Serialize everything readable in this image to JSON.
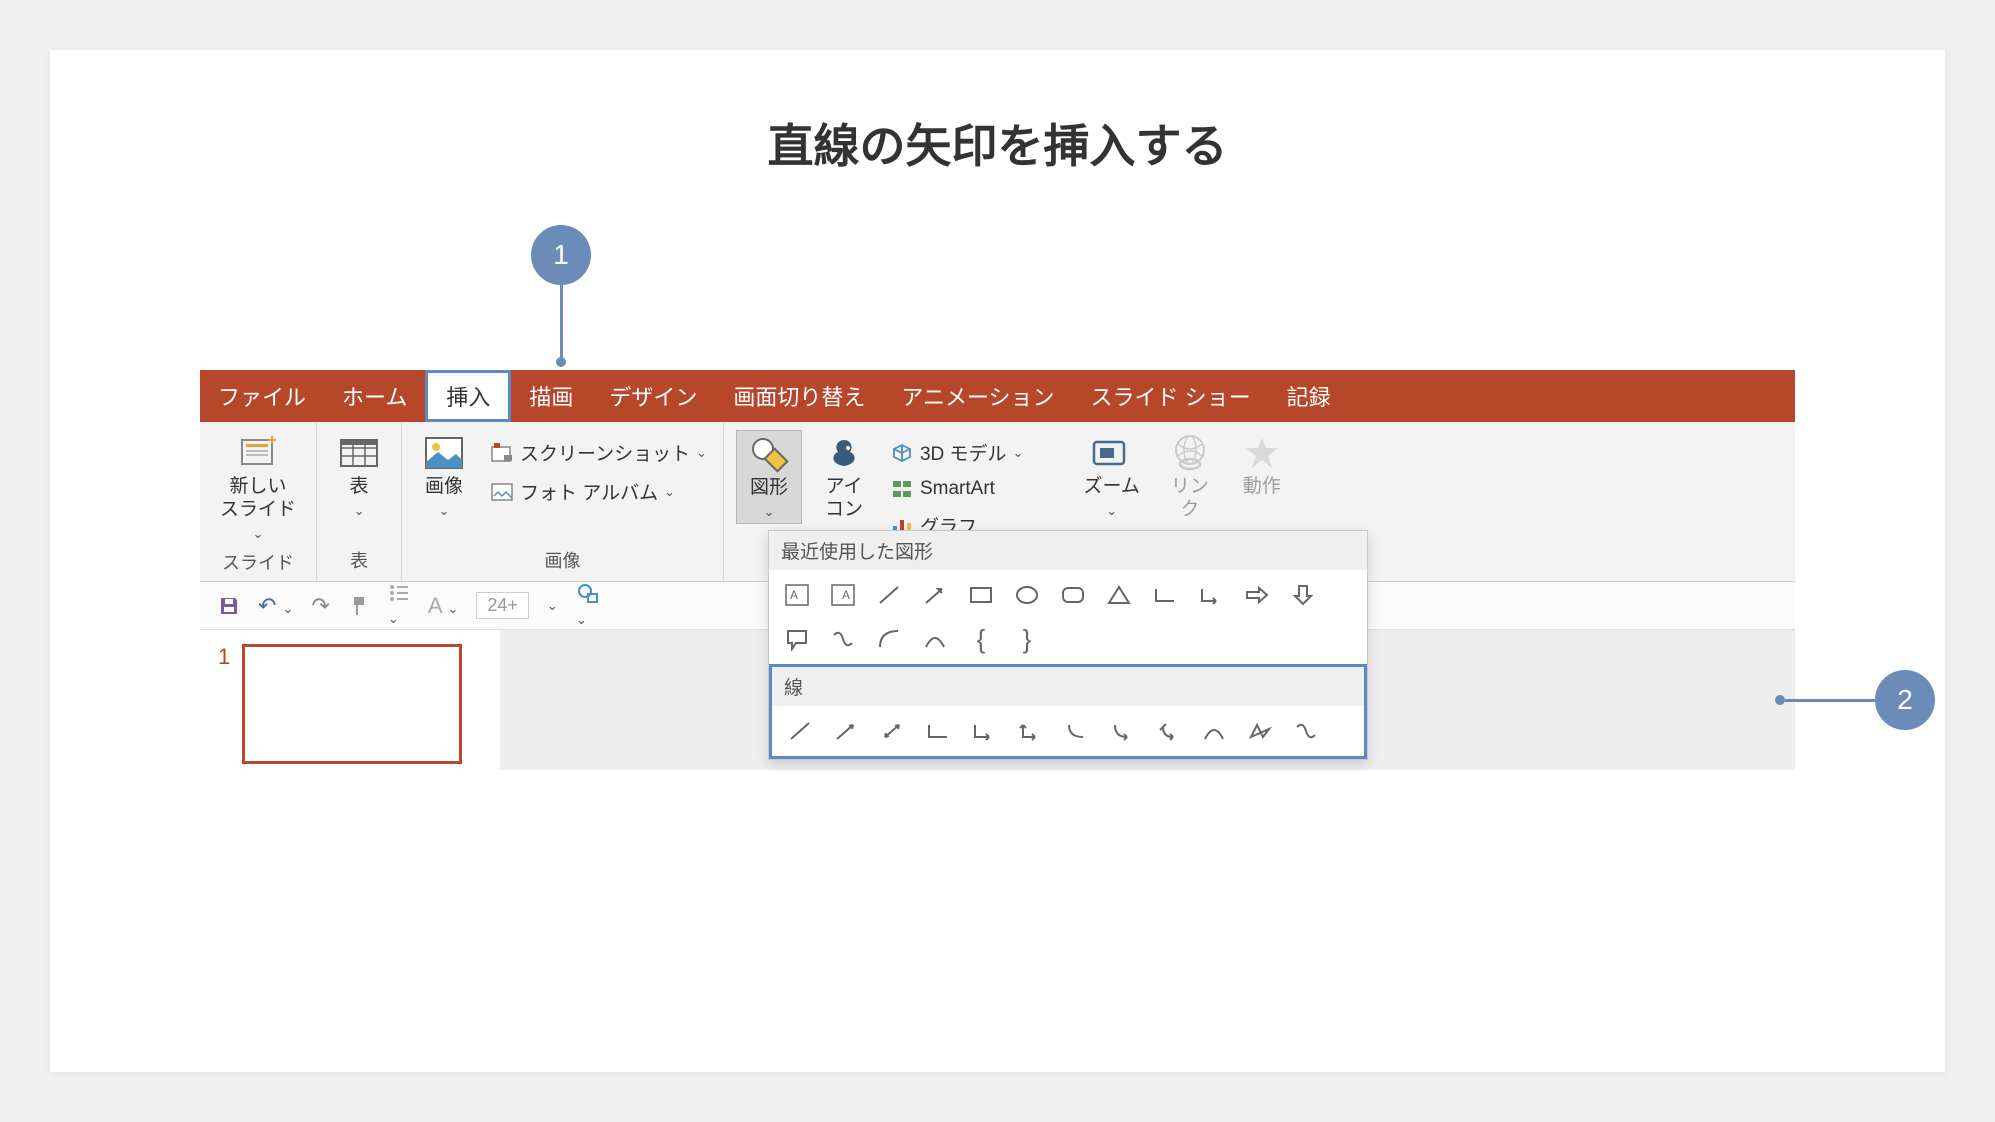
{
  "title": "直線の矢印を挿入する",
  "callouts": {
    "one": "1",
    "two": "2"
  },
  "tabs": {
    "file": "ファイル",
    "home": "ホーム",
    "insert": "挿入",
    "draw": "描画",
    "design": "デザイン",
    "transition": "画面切り替え",
    "animation": "アニメーション",
    "slideshow": "スライド ショー",
    "record": "記録"
  },
  "ribbon": {
    "newslide": "新しい\nスライド",
    "slide_group": "スライド",
    "table": "表",
    "table_group": "表",
    "image": "画像",
    "screenshot": "スクリーンショット",
    "photoalbum": "フォト アルバム",
    "image_group": "画像",
    "shapes": "図形",
    "icons": "アイ\nコン",
    "models3d": "3D モデル",
    "smartart": "SmartArt",
    "chart": "グラフ",
    "zoom": "ズーム",
    "link": "リン\nク",
    "action": "動作"
  },
  "popup": {
    "recent": "最近使用した図形",
    "lines": "線"
  },
  "qat": {
    "fontsize": "24+"
  },
  "slide": {
    "num": "1"
  }
}
